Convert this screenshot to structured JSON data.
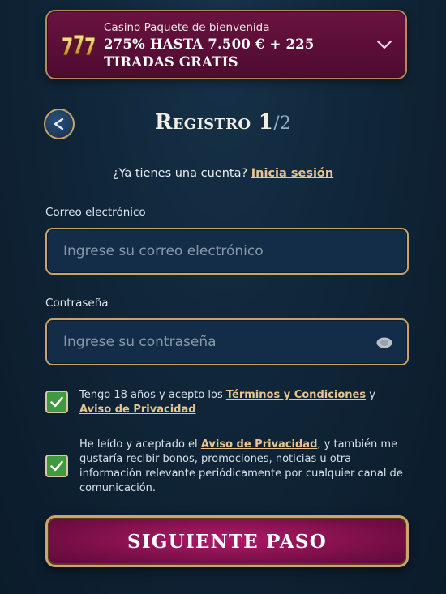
{
  "bonus": {
    "subtitle": "Casino Paquete de bienvenida",
    "title": "275% hasta 7.500 € + 225 tiradas gratis"
  },
  "header": {
    "title": "Registro 1",
    "step": "/2"
  },
  "login_prompt": {
    "text": "¿Ya tienes una cuenta?",
    "link": "Inicia sesión"
  },
  "form": {
    "email": {
      "label": "Correo electrónico",
      "placeholder": "Ingrese su correo electrónico",
      "value": ""
    },
    "password": {
      "label": "Contraseña",
      "placeholder": "Ingrese su contraseña",
      "value": ""
    }
  },
  "consents": [
    {
      "checked": true,
      "text_before": "Tengo 18 años y acepto los ",
      "link1": "Términos y Condiciones",
      "text_middle": " y ",
      "link2": "Aviso de Privacidad"
    },
    {
      "checked": true,
      "text_before": "He leído y aceptado el ",
      "link1": "Aviso de Privacidad",
      "text_after": ", y también me gustaría recibir bonos, promociones, noticias u otra información relevante periódicamente por cualquier canal de comunicación."
    }
  ],
  "next_button": {
    "label": "SIGUIENTE PASO"
  },
  "colors": {
    "gold": "#c9a36b",
    "checkbox_green": "#3f9a3d",
    "banner_purple": "#6a1240",
    "button_magenta": "#b01a6a",
    "link_gold": "#e8c48e"
  }
}
